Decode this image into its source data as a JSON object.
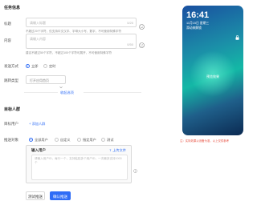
{
  "basic_section": {
    "title": "任务信息"
  },
  "title_field": {
    "label": "标题",
    "placeholder": "请输入标题",
    "counter": "0/20",
    "help": "不超过20个字符，仅支持中文汉字、字母大小写、数字，不可使用特殊字符"
  },
  "content_field": {
    "label": "内容",
    "placeholder": "请输入内容",
    "counter": "0/50",
    "help": "建议不超过50个字符，不超过100个字符可展开，不可使用特殊字符"
  },
  "send_type": {
    "label": "发送方式",
    "options": [
      "立即",
      "定时"
    ],
    "selected": "立即"
  },
  "jump_field": {
    "label": "跳转类型",
    "value": "打开应用首页"
  },
  "expand": {
    "label": "收起选项"
  },
  "target_section": {
    "title": "目标人群"
  },
  "target_user": {
    "label": "目标用户",
    "link": "+ 添加人群"
  },
  "push_to": {
    "label": "推送对象",
    "options": [
      "全部用户",
      "自定义",
      "指定用户",
      "测试"
    ],
    "selected": "全部用户"
  },
  "upload": {
    "title": "输入用户",
    "link": "上传文件",
    "placeholder": "请输入用户ID，每行一个，支持粘贴多个用户ID，一次最多支持1000个"
  },
  "buttons": {
    "preview": "测试推送",
    "submit": "确认推送"
  },
  "phone": {
    "time": "16:41",
    "date": "11月15日 星期三",
    "subtitle": "滑动来解锁",
    "center_label": "预览效果"
  },
  "preview_note": "注：实际效果以设备为准，以上仅供参考"
}
